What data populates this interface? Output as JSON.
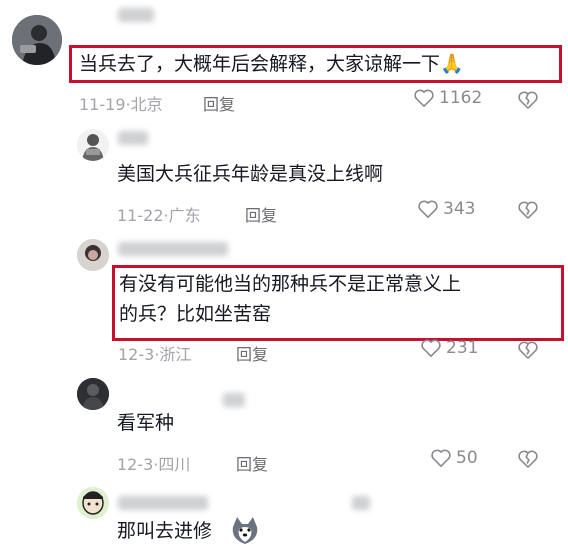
{
  "comments": [
    {
      "text_lines": [
        "当兵去了，大概年后会解释，大家谅解一下🙏"
      ],
      "date": "11-19",
      "location": "北京",
      "reply_label": "回复",
      "likes": "1162"
    },
    {
      "text_lines": [
        "美国大兵征兵年龄是真没上线啊"
      ],
      "date": "11-22",
      "location": "广东",
      "reply_label": "回复",
      "likes": "343"
    },
    {
      "text_lines": [
        "有没有可能他当的那种兵不是正常意义上",
        "的兵？比如坐苦窑"
      ],
      "date": "12-3",
      "location": "浙江",
      "reply_label": "回复",
      "likes": "231"
    },
    {
      "text_lines": [
        "看军种"
      ],
      "date": "12-3",
      "location": "四川",
      "reply_label": "回复",
      "likes": "50"
    },
    {
      "text_lines": [
        "那叫去进修"
      ]
    }
  ],
  "separator": "·",
  "colors": {
    "highlight_box": "#c8102e",
    "meta": "#a3a4a9",
    "text": "#161823"
  },
  "icons": {
    "like": "heart-outline-icon",
    "dislike": "broken-heart-icon",
    "emoji": "husky-dog-emoji"
  }
}
